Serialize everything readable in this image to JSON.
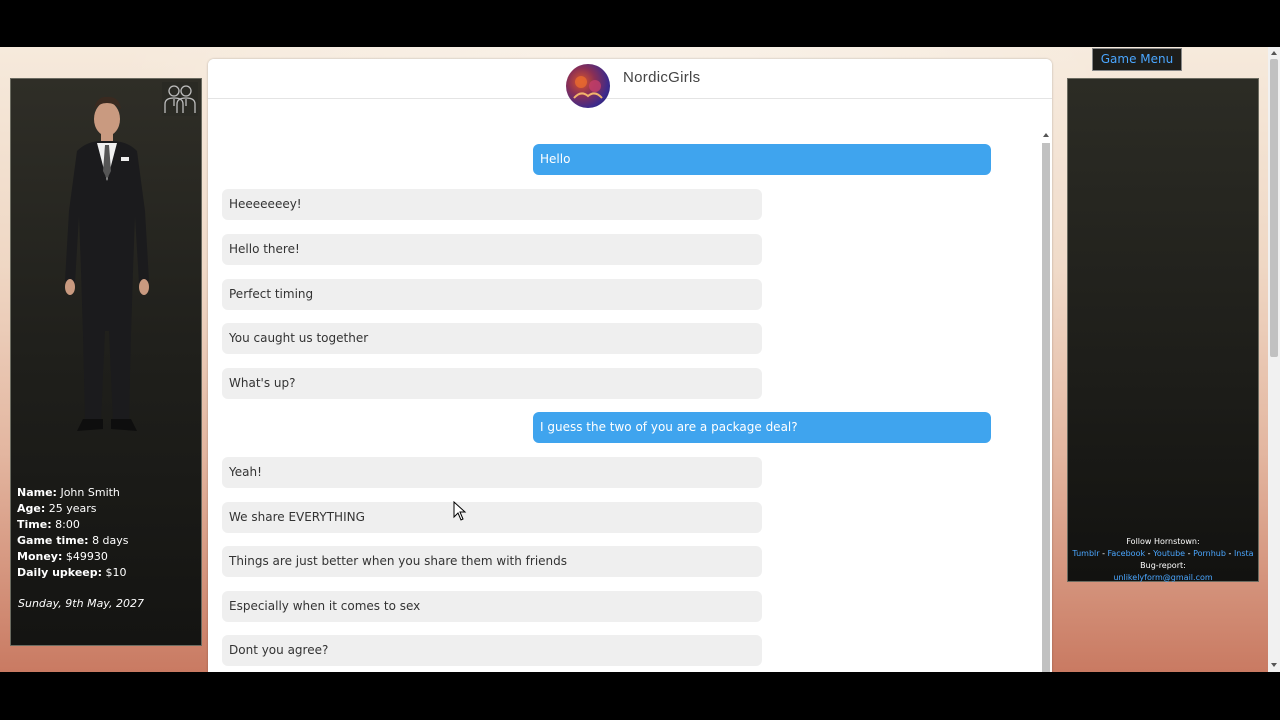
{
  "contact": {
    "name": "NordicGirls"
  },
  "player": {
    "name_label": "Name:",
    "name": "John Smith",
    "age_label": "Age:",
    "age": "25 years",
    "time_label": "Time:",
    "time": "8:00",
    "game_time_label": "Game time:",
    "game_time": "8 days",
    "money_label": "Money:",
    "money": "$49930",
    "upkeep_label": "Daily upkeep:",
    "upkeep": "$10",
    "date": "Sunday, 9th May, 2027"
  },
  "messages": [
    {
      "from": "me",
      "text": "Hello"
    },
    {
      "from": "them",
      "text": "Heeeeeeey!"
    },
    {
      "from": "them",
      "text": "Hello there!"
    },
    {
      "from": "them",
      "text": "Perfect timing"
    },
    {
      "from": "them",
      "text": "You caught us together"
    },
    {
      "from": "them",
      "text": "What's up?"
    },
    {
      "from": "me",
      "text": "I guess the two of you are a package deal?"
    },
    {
      "from": "them",
      "text": "Yeah!"
    },
    {
      "from": "them",
      "text": "We share EVERYTHING"
    },
    {
      "from": "them",
      "text": "Things are just better when you share them with friends"
    },
    {
      "from": "them",
      "text": "Especially when it comes to sex"
    },
    {
      "from": "them",
      "text": "Dont you agree?"
    }
  ],
  "menu": {
    "game_menu_label": "Game Menu"
  },
  "footer": {
    "follow_label": "Follow Hornstown:",
    "links": [
      "Tumblr",
      "Facebook",
      "Youtube",
      "Pornhub",
      "Insta"
    ],
    "separator": " - ",
    "bug_label": "Bug-report:",
    "email": "unlikelyform@gmail.com"
  },
  "colors": {
    "outgoing": "#3fa4ee",
    "incoming": "#efefef",
    "link": "#4aa6ff"
  },
  "icons": [
    "friends-icon",
    "cursor-icon"
  ]
}
